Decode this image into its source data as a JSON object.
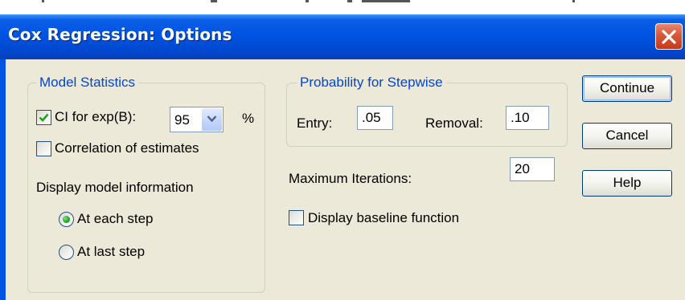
{
  "window": {
    "title": "Cox Regression: Options"
  },
  "model_statistics": {
    "group_label": "Model Statistics",
    "ci": {
      "label": "CI for exp(B):",
      "checked": true,
      "value": "95",
      "unit": "%"
    },
    "correlation": {
      "label": "Correlation of estimates",
      "checked": false
    },
    "display_model_label": "Display model information",
    "radio_options": [
      {
        "label": "At each step",
        "selected": true
      },
      {
        "label": "At last step",
        "selected": false
      }
    ]
  },
  "stepwise": {
    "group_label": "Probability for Stepwise",
    "entry_label": "Entry:",
    "entry_value": ".05",
    "removal_label": "Removal:",
    "removal_value": ".10"
  },
  "max_iterations": {
    "label": "Maximum Iterations:",
    "value": "20"
  },
  "baseline": {
    "label": "Display baseline function",
    "checked": false
  },
  "buttons": {
    "continue": "Continue",
    "cancel": "Cancel",
    "help": "Help"
  },
  "colors": {
    "title_bar": "#0054e3",
    "group_label": "#0046d5",
    "dialog_bg": "#ece9d8",
    "close_button": "#d8583a"
  },
  "icons": {
    "close": "close-icon",
    "dropdown": "chevron-down-icon",
    "check": "check-icon"
  }
}
